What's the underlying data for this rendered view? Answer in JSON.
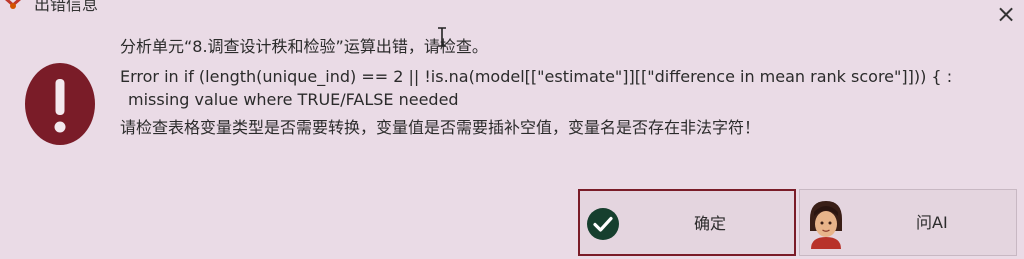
{
  "window": {
    "title": "出错信息",
    "close_symbol": "×",
    "icons": {
      "app": "app-logo-icon",
      "close": "close-icon",
      "error": "exclamation-error-icon"
    }
  },
  "message": {
    "line1": "分析单元“8.调查设计秩和检验”运算出错，请检查。",
    "line2": "Error in if (length(unique_ind) == 2 || !is.na(model[[\"estimate\"]][[\"difference in mean rank score\"]])) { :",
    "line3": "missing value where TRUE/FALSE needed",
    "line4": "请检查表格变量类型是否需要转换，变量值是否需要插补空值，变量名是否存在非法字符！"
  },
  "buttons": {
    "ok_label": "确定",
    "ask_ai_label": "问AI",
    "ok_icon": "check-circle-icon",
    "ai_icon": "ai-assistant-avatar-icon"
  },
  "colors": {
    "background": "#eadbe6",
    "error_icon": "#7a1c28",
    "ok_icon": "#163f2e",
    "ok_border": "#7a1c28"
  }
}
